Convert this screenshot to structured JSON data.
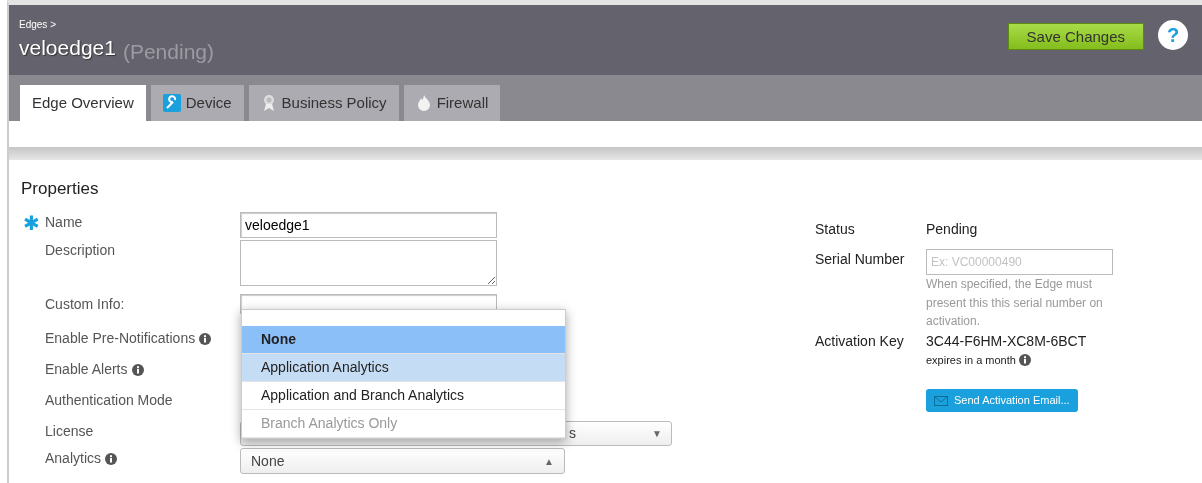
{
  "breadcrumb": "Edges >",
  "title": "veloedge1",
  "title_status": "(Pending)",
  "save_button": "Save Changes",
  "help_button": "?",
  "tabs": [
    {
      "label": "Edge Overview",
      "selected": true
    },
    {
      "label": "Device",
      "selected": false
    },
    {
      "label": "Business Policy",
      "selected": false
    },
    {
      "label": "Firewall",
      "selected": false
    }
  ],
  "section_title": "Properties",
  "fields": [
    {
      "label": "Name",
      "required_mark": "✱",
      "info": false,
      "kind": "text",
      "value": "veloedge1"
    },
    {
      "label": "Description",
      "info": false,
      "kind": "textarea"
    },
    {
      "label": "Custom Info:",
      "info": false,
      "kind": "covered"
    },
    {
      "label": "Enable Pre-Notifications",
      "info": true,
      "kind": "hidden"
    },
    {
      "label": "Enable Alerts",
      "info": true,
      "kind": "hidden"
    },
    {
      "label": "Authentication Mode",
      "info": false,
      "kind": "hidden"
    },
    {
      "label": "License",
      "info": false,
      "kind": "select_covered",
      "value": "s",
      "caret": "▼"
    },
    {
      "label": "Analytics",
      "info": true,
      "kind": "select_open",
      "value": "None",
      "caret": "▲"
    }
  ],
  "dropdown_options": [
    {
      "label": "None",
      "selected": true,
      "highlighted": false,
      "disabled": false
    },
    {
      "label": "Application Analytics",
      "selected": false,
      "highlighted": true,
      "disabled": false
    },
    {
      "label": "Application and Branch Analytics",
      "selected": false,
      "highlighted": false,
      "disabled": false
    },
    {
      "label": "Branch Analytics Only",
      "selected": false,
      "highlighted": false,
      "disabled": true
    }
  ],
  "status": {
    "label": "Status",
    "value": "Pending"
  },
  "serial_number": {
    "label": "Serial Number",
    "placeholder": "Ex: VC00000490",
    "help": "When specified, the Edge must present this this serial number on activation."
  },
  "activation_key": {
    "label": "Activation Key",
    "value": "3C44-F6HM-XC8M-6BCT",
    "expiry": "expires in a month"
  },
  "send_button": "Send Activation Email..."
}
